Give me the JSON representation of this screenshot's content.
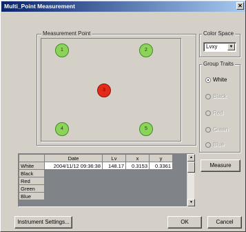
{
  "window": {
    "title": "Multi_Point Measurement",
    "close_glyph": "✕"
  },
  "measurement_point": {
    "group_title": "Measurement Point",
    "points": [
      {
        "label": "1",
        "active": false
      },
      {
        "label": "2",
        "active": false
      },
      {
        "label": "3",
        "active": true
      },
      {
        "label": "4",
        "active": false
      },
      {
        "label": "5",
        "active": false
      }
    ]
  },
  "color_space": {
    "group_title": "Color Space",
    "selected": "Lvxy",
    "arrow_glyph": "▼"
  },
  "group_traits": {
    "group_title": "Group Traits",
    "options": [
      {
        "label": "White",
        "checked": true,
        "enabled": true
      },
      {
        "label": "Black",
        "checked": false,
        "enabled": false
      },
      {
        "label": "Red",
        "checked": false,
        "enabled": false
      },
      {
        "label": "Green",
        "checked": false,
        "enabled": false
      },
      {
        "label": "Blue",
        "checked": false,
        "enabled": false
      }
    ]
  },
  "buttons": {
    "measure": "Measure",
    "instrument_settings": "Instrument Settings...",
    "ok": "OK",
    "cancel": "Cancel"
  },
  "table": {
    "headers": [
      "",
      "Date",
      "Lv",
      "x",
      "y"
    ],
    "rows": [
      {
        "name": "White",
        "date": "2004/11/12 09:36:38",
        "lv": "148.17",
        "x": "0.3153",
        "y": "0.3361"
      },
      {
        "name": "Black",
        "date": "",
        "lv": "",
        "x": "",
        "y": ""
      },
      {
        "name": "Red",
        "date": "",
        "lv": "",
        "x": "",
        "y": ""
      },
      {
        "name": "Green",
        "date": "",
        "lv": "",
        "x": "",
        "y": ""
      },
      {
        "name": "Blue",
        "date": "",
        "lv": "",
        "x": "",
        "y": ""
      }
    ],
    "scroll_up_glyph": "▲",
    "scroll_down_glyph": "▼"
  }
}
